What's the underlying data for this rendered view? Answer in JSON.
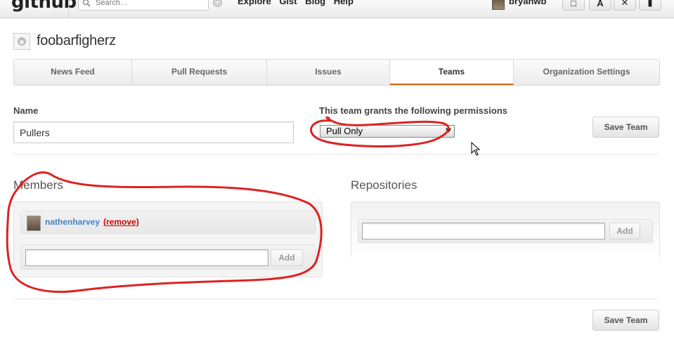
{
  "topbar": {
    "logo": "github",
    "search_placeholder": "Search…",
    "nav": [
      "Explore",
      "Gist",
      "Blog",
      "Help"
    ],
    "username": "bryanwb",
    "icons": [
      "dashboard-icon",
      "account-settings-icon",
      "tools-icon",
      "sign-out-icon"
    ]
  },
  "org": {
    "name": "foobarfigherz"
  },
  "tabs": [
    {
      "label": "News Feed",
      "active": false
    },
    {
      "label": "Pull Requests",
      "active": false
    },
    {
      "label": "Issues",
      "active": false
    },
    {
      "label": "Teams",
      "active": true
    },
    {
      "label": "Organization Settings",
      "active": false
    }
  ],
  "team_form": {
    "name_label": "Name",
    "name_value": "Pullers",
    "permissions_label": "This team grants the following permissions",
    "permission_selected": "Pull Only",
    "save_label": "Save Team"
  },
  "members": {
    "title": "Members",
    "items": [
      {
        "name": "nathenharvey",
        "remove_label": "(remove)"
      }
    ],
    "add_label": "Add"
  },
  "repositories": {
    "title": "Repositories",
    "add_label": "Add"
  },
  "footer": {
    "save_label": "Save Team"
  },
  "colors": {
    "accent_tab_underline": "#d26911",
    "link": "#4183c4",
    "remove": "#cc0000",
    "annotation": "#dd2222"
  }
}
